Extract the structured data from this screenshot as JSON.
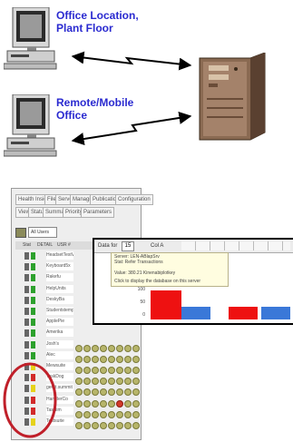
{
  "labels": {
    "office_location": [
      "Office Location,",
      "Plant Floor"
    ],
    "remote_office": [
      "Remote/Mobile",
      "Office"
    ]
  },
  "screenshot": {
    "tabs_row1": [
      "Health Insight",
      "File",
      "Server",
      "Managing",
      "Publication",
      "Configuration"
    ],
    "tabs_row2": [
      "View",
      "Status",
      "Summary",
      "Priority",
      "Parameters"
    ],
    "filter_value": "All Users",
    "column_headers": [
      "Stat",
      "DETAIL",
      "USR #"
    ],
    "rows": [
      {
        "name": "HeadsetTestVa",
        "status": "green"
      },
      {
        "name": "Keyboard5x",
        "status": "green"
      },
      {
        "name": "Rakefu",
        "status": "green"
      },
      {
        "name": "HelpUnits",
        "status": "green"
      },
      {
        "name": "DeskyBa",
        "status": "green"
      },
      {
        "name": "Studentstemp",
        "status": "green"
      },
      {
        "name": "ApplePie",
        "status": "green"
      },
      {
        "name": "Amerika",
        "status": "green"
      },
      {
        "name": "Josh's",
        "status": "green"
      },
      {
        "name": "Alec",
        "status": "green"
      },
      {
        "name": "Mewsuite",
        "status": "yellow"
      },
      {
        "name": "TaskDog",
        "status": "red"
      },
      {
        "name": "gerrit.summit",
        "status": "yellow"
      },
      {
        "name": "HandlerCo",
        "status": "red"
      },
      {
        "name": "Tasklim",
        "status": "red"
      },
      {
        "name": "Testsuite",
        "status": "yellow"
      }
    ]
  },
  "popup": {
    "header": [
      "Data for",
      "15",
      "Col A"
    ],
    "lines": [
      "Server: LEN-ABlapSrv",
      "Stat: Refer Transactions",
      "",
      "Value: 380.21 Kinenabiplotkey",
      "",
      "Click to display the database on this server"
    ],
    "y_ticks": [
      "100",
      "50",
      "0"
    ]
  },
  "colors": {
    "label_blue": "#2a2ad0",
    "bar_red": "#ee1111",
    "bar_blue": "#3a78d8",
    "ellipse_red": "#c0202a"
  }
}
